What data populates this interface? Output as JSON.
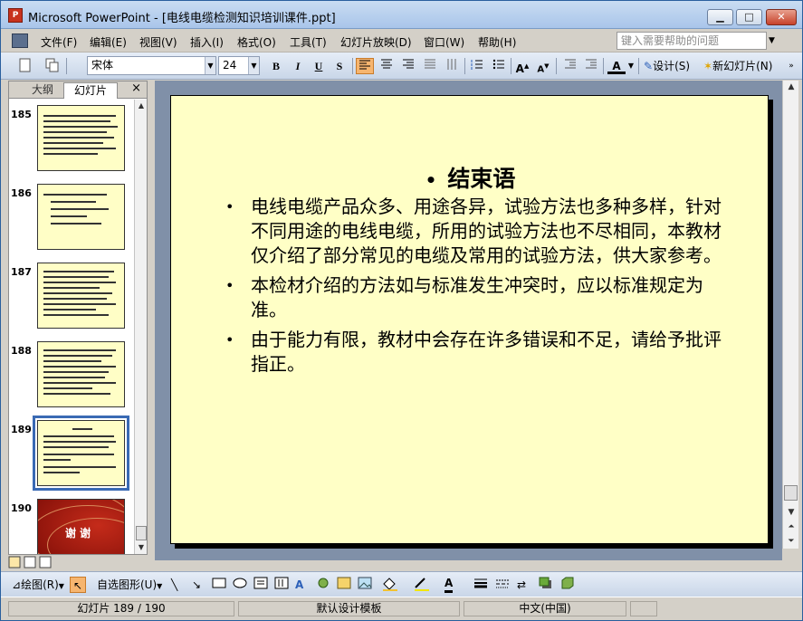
{
  "window": {
    "app_icon": "powerpoint-icon",
    "title": "Microsoft PowerPoint - [电线电缆检测知识培训课件.ppt]",
    "minimize": "▁",
    "maximize": "□",
    "close": "✕"
  },
  "menu": {
    "items": [
      "文件(F)",
      "编辑(E)",
      "视图(V)",
      "插入(I)",
      "格式(O)",
      "工具(T)",
      "幻灯片放映(D)",
      "窗口(W)",
      "帮助(H)"
    ],
    "help_placeholder": "键入需要帮助的问题"
  },
  "toolbar": {
    "font_name": "宋体",
    "font_size": "24",
    "bold": "B",
    "italic": "I",
    "underline": "U",
    "shadow": "S",
    "font_color_label": "A",
    "design_label": "设计(S)",
    "new_slide_label": "新幻灯片(N)"
  },
  "panel": {
    "tab_outline": "大纲",
    "tab_slides": "幻灯片",
    "close": "×",
    "thumbnails": [
      {
        "number": "185",
        "kind": "text"
      },
      {
        "number": "186",
        "kind": "text"
      },
      {
        "number": "187",
        "kind": "text"
      },
      {
        "number": "188",
        "kind": "text"
      },
      {
        "number": "189",
        "kind": "text",
        "selected": true
      },
      {
        "number": "190",
        "kind": "thanks",
        "thanks_text": "谢  谢"
      }
    ]
  },
  "slide": {
    "title": "结束语",
    "title_bullet": "•",
    "bullet": "•",
    "bullets": [
      "电线电缆产品众多、用途各异，试验方法也多种多样，针对不同用途的电线电缆，所用的试验方法也不尽相同，本教材仅介绍了部分常见的电缆及常用的试验方法，供大家参考。",
      "本检材介绍的方法如与标准发生冲突时，应以标准规定为准。",
      "由于能力有限，教材中会存在许多错误和不足，请给予批评指正。"
    ]
  },
  "drawing_toolbar": {
    "draw_label": "绘图(R)",
    "autoshapes_label": "自选图形(U)"
  },
  "status": {
    "slide_position": "幻灯片 189 / 190",
    "template": "默认设计模板",
    "language": "中文(中国)"
  },
  "colors": {
    "slide_background": "#ffffc6",
    "editor_background": "#8090a8",
    "selection": "#3a6ab4"
  }
}
